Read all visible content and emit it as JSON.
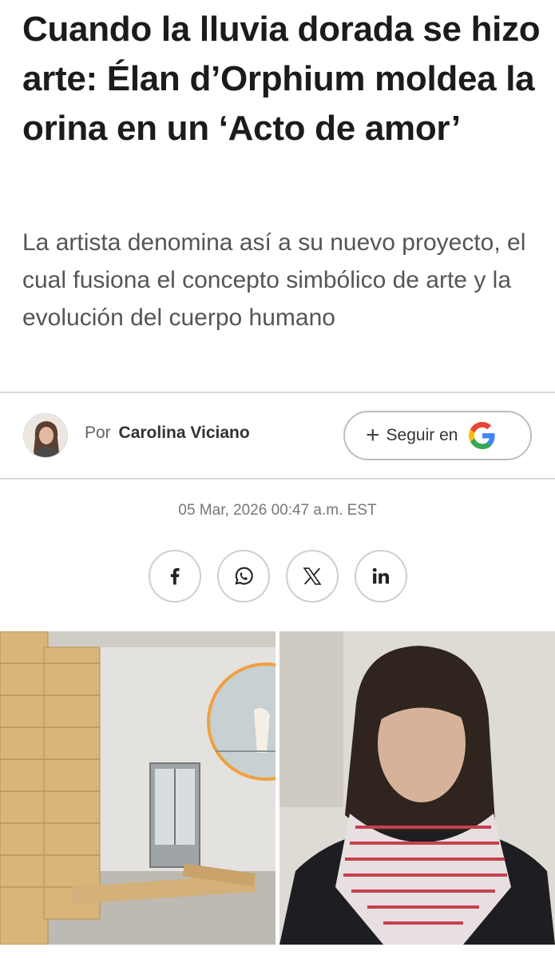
{
  "article": {
    "headline": "Cuando la lluvia dorada se hizo arte: Élan d’Orphium moldea la orina en un ‘Acto de amor’",
    "subhead": "La artista denomina así a su nuevo proyecto, el cual fusiona el concepto simbólico de arte y la evolución del cuerpo humano",
    "date": "05 Mar, 2026 00:47 a.m. EST"
  },
  "byline": {
    "prefix": "Por",
    "author": "Carolina Viciano"
  },
  "follow": {
    "plus": "+",
    "label": "Seguir en",
    "icon": "google-icon"
  },
  "share": [
    {
      "icon": "facebook-icon"
    },
    {
      "icon": "whatsapp-icon"
    },
    {
      "icon": "x-icon"
    },
    {
      "icon": "linkedin-icon"
    }
  ],
  "colors": {
    "headline": "#1b1b1b",
    "subhead": "#555555",
    "google_blue": "#4285F4",
    "google_red": "#EA4335",
    "google_yellow": "#FBBC05",
    "google_green": "#34A853",
    "inset_ring": "#f0a040"
  }
}
